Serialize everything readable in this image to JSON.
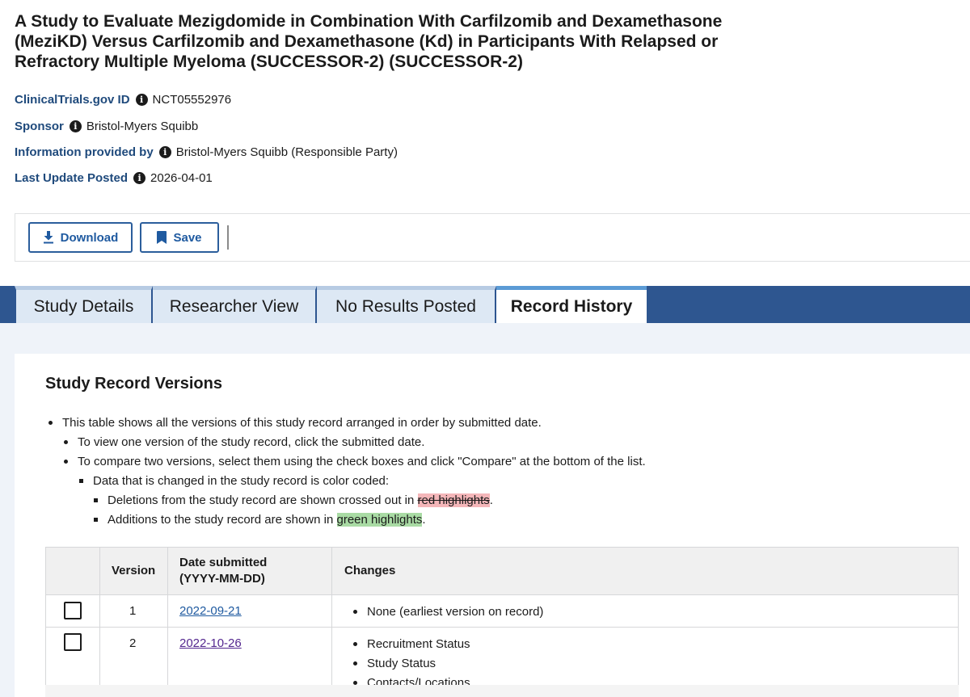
{
  "header": {
    "title": "A Study to Evaluate Mezigdomide in Combination With Carfilzomib and Dexamethasone (MeziKD) Versus Carfilzomib and Dexamethasone (Kd) in Participants With Relapsed or Refractory Multiple Myeloma (SUCCESSOR-2) (SUCCESSOR-2)"
  },
  "meta": {
    "id_label": "ClinicalTrials.gov ID",
    "id_value": "NCT05552976",
    "sponsor_label": "Sponsor",
    "sponsor_value": "Bristol-Myers Squibb",
    "info_label": "Information provided by",
    "info_value": "Bristol-Myers Squibb (Responsible Party)",
    "update_label": "Last Update Posted",
    "update_value": "2026-04-01",
    "info_glyph": "i"
  },
  "toolbar": {
    "download_label": "Download",
    "save_label": "Save",
    "download_icon": "download-icon",
    "save_icon": "bookmark-icon"
  },
  "tabs": [
    {
      "label": "Study Details"
    },
    {
      "label": "Researcher View"
    },
    {
      "label": "No Results Posted"
    },
    {
      "label": "Record History",
      "active": true
    }
  ],
  "versions": {
    "title": "Study Record Versions",
    "intro": "This table shows all the versions of this study record arranged in order by submitted date.",
    "tip1": "To view one version of the study record, click the submitted date.",
    "tip2": "To compare two versions, select them using the check boxes and click \"Compare\" at the bottom of the list.",
    "color_note": "Data that is changed in the study record is color coded:",
    "del_text": "Deletions from the study record are shown crossed out in ",
    "del_hl": "red highlights",
    "add_text": "Additions to the study record are shown in ",
    "add_hl": "green highlights",
    "period": "."
  },
  "table": {
    "col_version": "Version",
    "col_date_1": "Date submitted",
    "col_date_2": "(YYYY-MM-DD)",
    "col_changes": "Changes",
    "rows": [
      {
        "version": "1",
        "date": "2022-09-21",
        "changes": [
          "None (earliest version on record)"
        ]
      },
      {
        "version": "2",
        "date": "2022-10-26",
        "changes": [
          "Recruitment Status",
          "Study Status",
          "Contacts/Locations"
        ]
      }
    ]
  },
  "colors": {
    "brand_blue": "#2e5690",
    "link_blue": "#1f5aa0",
    "label_blue": "#1f4a7c",
    "deletion": "#f4b6b9",
    "addition": "#a9dba4"
  }
}
